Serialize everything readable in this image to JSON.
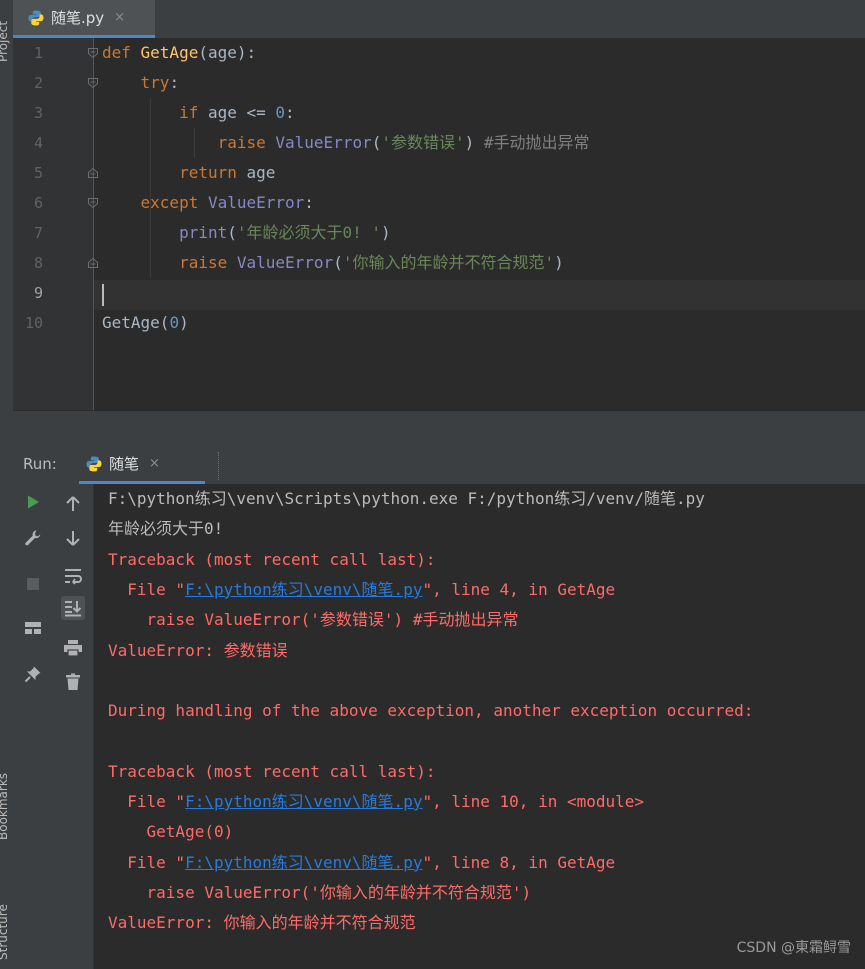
{
  "sidebar": {
    "project_label": "Project",
    "bookmarks_label": "Bookmarks",
    "structure_label": "Structure"
  },
  "editor_tab": {
    "filename": "随笔.py",
    "close": "×"
  },
  "editor": {
    "current_line": 9,
    "lines": [
      {
        "n": "1",
        "tokens": [
          [
            "kw",
            "def "
          ],
          [
            "fn",
            "GetAge"
          ],
          [
            "pn",
            "(age):"
          ]
        ]
      },
      {
        "n": "2",
        "tokens": [
          [
            "kw",
            "    try"
          ],
          [
            "pn",
            ":"
          ]
        ]
      },
      {
        "n": "3",
        "tokens": [
          [
            "kw",
            "        if "
          ],
          [
            "pn",
            "age <= "
          ],
          [
            "num",
            "0"
          ],
          [
            "pn",
            ":"
          ]
        ]
      },
      {
        "n": "4",
        "tokens": [
          [
            "kw",
            "            raise "
          ],
          [
            "bi",
            "ValueError"
          ],
          [
            "pn",
            "("
          ],
          [
            "str",
            "'参数错误'"
          ],
          [
            "pn",
            ") "
          ],
          [
            "cmt",
            "#手动抛出异常"
          ]
        ]
      },
      {
        "n": "5",
        "tokens": [
          [
            "kw",
            "        return "
          ],
          [
            "pn",
            "age"
          ]
        ]
      },
      {
        "n": "6",
        "tokens": [
          [
            "kw",
            "    except "
          ],
          [
            "bi",
            "ValueError"
          ],
          [
            "pn",
            ":"
          ]
        ]
      },
      {
        "n": "7",
        "tokens": [
          [
            "bi",
            "        print"
          ],
          [
            "pn",
            "("
          ],
          [
            "str",
            "'年龄必须大于0! '"
          ],
          [
            "pn",
            ")"
          ]
        ]
      },
      {
        "n": "8",
        "tokens": [
          [
            "kw",
            "        raise "
          ],
          [
            "bi",
            "ValueError"
          ],
          [
            "pn",
            "("
          ],
          [
            "str",
            "'你输入的年龄并不符合规范'"
          ],
          [
            "pn",
            ")"
          ]
        ]
      },
      {
        "n": "9",
        "tokens": []
      },
      {
        "n": "10",
        "tokens": [
          [
            "pn",
            "GetAge("
          ],
          [
            "num",
            "0"
          ],
          [
            "pn",
            ")"
          ]
        ]
      }
    ]
  },
  "run_panel": {
    "title": "Run:",
    "tab_label": "随笔",
    "tab_close": "×",
    "toolbar_left": [
      "run-icon",
      "wrench-icon",
      "stop-icon",
      "layout-icon",
      "pin-icon"
    ],
    "toolbar_right": [
      "arrow-up-icon",
      "arrow-down-icon",
      "soft-wrap-icon",
      "scroll-to-end-icon",
      "print-icon",
      "trash-icon"
    ]
  },
  "console": {
    "lines": [
      {
        "kind": "normal",
        "parts": [
          [
            "t",
            "F:\\python练习\\venv\\Scripts\\python.exe F:/python练习/venv/随笔.py"
          ]
        ]
      },
      {
        "kind": "normal",
        "parts": [
          [
            "t",
            "年龄必须大于0!"
          ]
        ]
      },
      {
        "kind": "err",
        "parts": [
          [
            "t",
            "Traceback (most recent call last):"
          ]
        ]
      },
      {
        "kind": "err",
        "parts": [
          [
            "t",
            "  File \""
          ],
          [
            "link",
            "F:\\python练习\\venv\\随笔.py"
          ],
          [
            "t",
            "\", line 4, in GetAge"
          ]
        ]
      },
      {
        "kind": "err",
        "parts": [
          [
            "t",
            "    raise ValueError('参数错误') #手动抛出异常"
          ]
        ]
      },
      {
        "kind": "err",
        "parts": [
          [
            "t",
            "ValueError: 参数错误"
          ]
        ]
      },
      {
        "kind": "err",
        "parts": []
      },
      {
        "kind": "err",
        "parts": [
          [
            "t",
            "During handling of the above exception, another exception occurred:"
          ]
        ]
      },
      {
        "kind": "err",
        "parts": []
      },
      {
        "kind": "err",
        "parts": [
          [
            "t",
            "Traceback (most recent call last):"
          ]
        ]
      },
      {
        "kind": "err",
        "parts": [
          [
            "t",
            "  File \""
          ],
          [
            "link",
            "F:\\python练习\\venv\\随笔.py"
          ],
          [
            "t",
            "\", line 10, in <module>"
          ]
        ]
      },
      {
        "kind": "err",
        "parts": [
          [
            "t",
            "    GetAge(0)"
          ]
        ]
      },
      {
        "kind": "err",
        "parts": [
          [
            "t",
            "  File \""
          ],
          [
            "link",
            "F:\\python练习\\venv\\随笔.py"
          ],
          [
            "t",
            "\", line 8, in GetAge"
          ]
        ]
      },
      {
        "kind": "err",
        "parts": [
          [
            "t",
            "    raise ValueError('你输入的年龄并不符合规范')"
          ]
        ]
      },
      {
        "kind": "err",
        "parts": [
          [
            "t",
            "ValueError: 你输入的年龄并不符合规范"
          ]
        ]
      }
    ]
  },
  "watermark": "CSDN @東霜鲟雪"
}
